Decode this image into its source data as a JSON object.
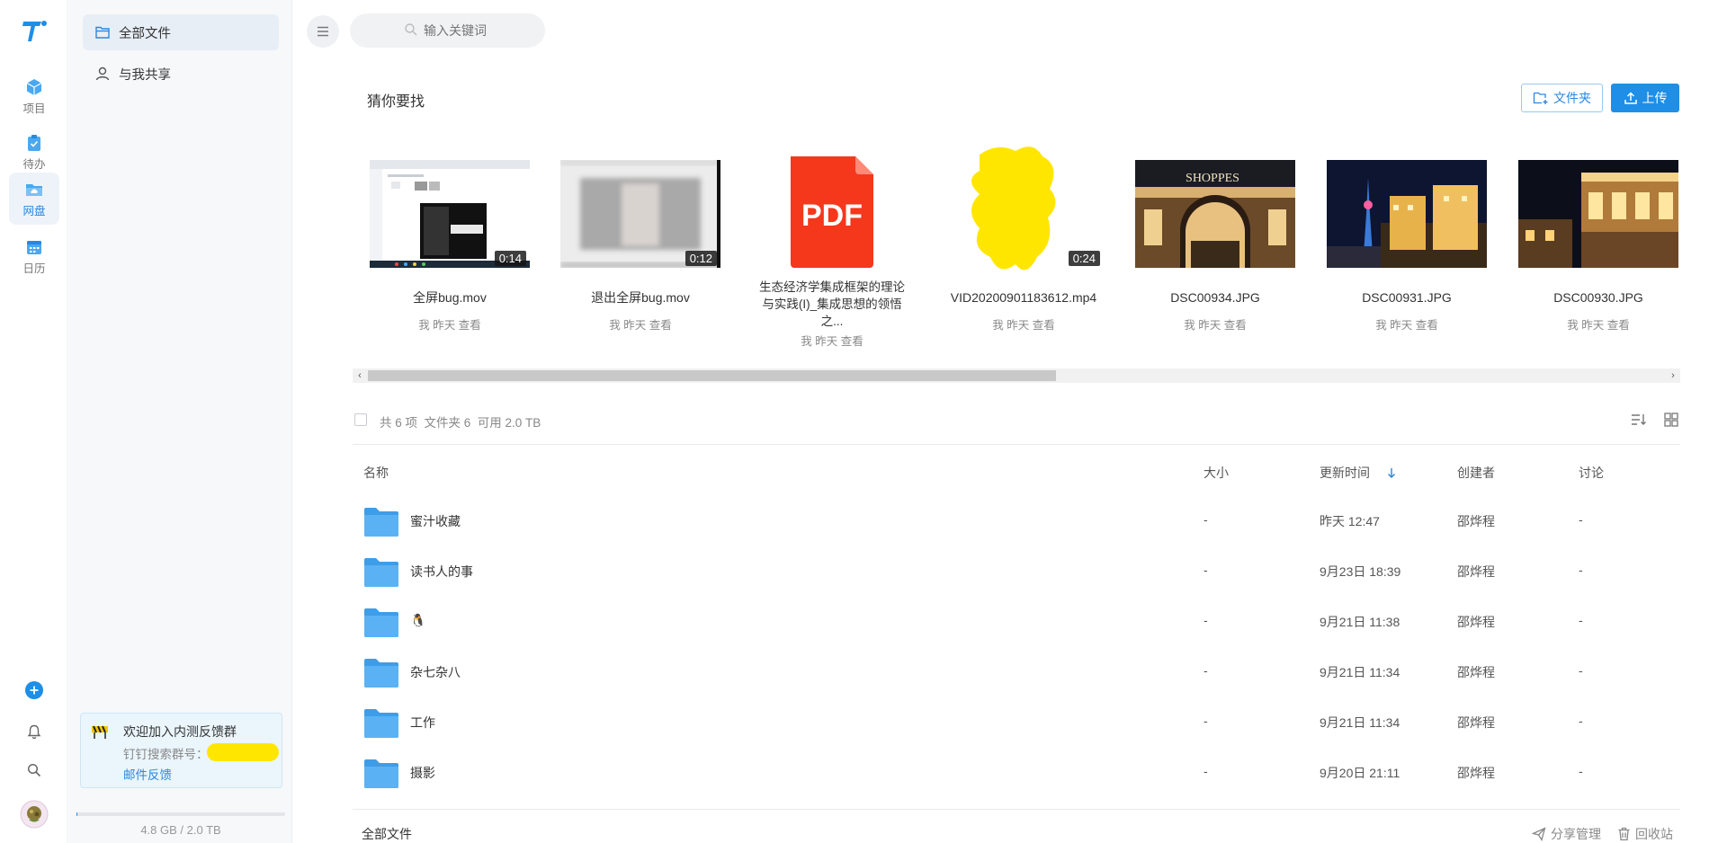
{
  "rail": {
    "items": [
      {
        "label": "项目"
      },
      {
        "label": "待办"
      },
      {
        "label": "网盘"
      },
      {
        "label": "日历"
      }
    ]
  },
  "nav": {
    "items": [
      {
        "label": "全部文件"
      },
      {
        "label": "与我共享"
      }
    ],
    "promo": {
      "title": "欢迎加入内测反馈群",
      "subtitle": "钉钉搜索群号：",
      "link": "邮件反馈"
    },
    "storage": "4.8 GB / 2.0 TB",
    "storage_used_fraction": 0.0023
  },
  "search": {
    "placeholder": "输入关键词"
  },
  "recommend": {
    "title": "猜你要找",
    "new_folder_label": "文件夹",
    "upload_label": "上传",
    "items": [
      {
        "name": "全屏bug.mov",
        "meta": "我 昨天 查看",
        "duration": "0:14",
        "kind": "video-screen"
      },
      {
        "name": "退出全屏bug.mov",
        "meta": "我 昨天 查看",
        "duration": "0:12",
        "kind": "video-blur"
      },
      {
        "name": "生态经济学集成框架的理论与实践(I)_集成思想的领悟之...",
        "meta": "我 昨天 查看",
        "duration": "",
        "kind": "pdf",
        "badge": "PDF"
      },
      {
        "name": "VID20200901183612.mp4",
        "meta": "我 昨天 查看",
        "duration": "0:24",
        "kind": "video-redacted"
      },
      {
        "name": "DSC00934.JPG",
        "meta": "我 昨天 查看",
        "duration": "",
        "kind": "photo-arch",
        "photo_text": "SHOPPES"
      },
      {
        "name": "DSC00931.JPG",
        "meta": "我 昨天 查看",
        "duration": "",
        "kind": "photo-tower"
      },
      {
        "name": "DSC00930.JPG",
        "meta": "我 昨天 查看",
        "duration": "",
        "kind": "photo-building"
      }
    ]
  },
  "list": {
    "summary": "共 6 项  文件夹 6  可用 2.0 TB",
    "columns": {
      "name": "名称",
      "size": "大小",
      "time": "更新时间",
      "creator": "创建者",
      "discuss": "讨论"
    },
    "rows": [
      {
        "name": "蜜汁收藏",
        "size": "-",
        "time": "昨天 12:47",
        "creator": "邵烨程",
        "discuss": "-"
      },
      {
        "name": "读书人的事",
        "size": "-",
        "time": "9月23日 18:39",
        "creator": "邵烨程",
        "discuss": "-"
      },
      {
        "name": "🐧",
        "size": "-",
        "time": "9月21日 11:38",
        "creator": "邵烨程",
        "discuss": "-"
      },
      {
        "name": "杂七杂八",
        "size": "-",
        "time": "9月21日 11:34",
        "creator": "邵烨程",
        "discuss": "-"
      },
      {
        "name": "工作",
        "size": "-",
        "time": "9月21日 11:34",
        "creator": "邵烨程",
        "discuss": "-"
      },
      {
        "name": "摄影",
        "size": "-",
        "time": "9月20日 21:11",
        "creator": "邵烨程",
        "discuss": "-"
      }
    ]
  },
  "footer": {
    "breadcrumb": "全部文件",
    "share_label": "分享管理",
    "trash_label": "回收站"
  },
  "colors": {
    "accent": "#1e8ee6",
    "folder": "#4aa8f0",
    "pdf": "#f5371c",
    "redaction": "#ffe600"
  }
}
